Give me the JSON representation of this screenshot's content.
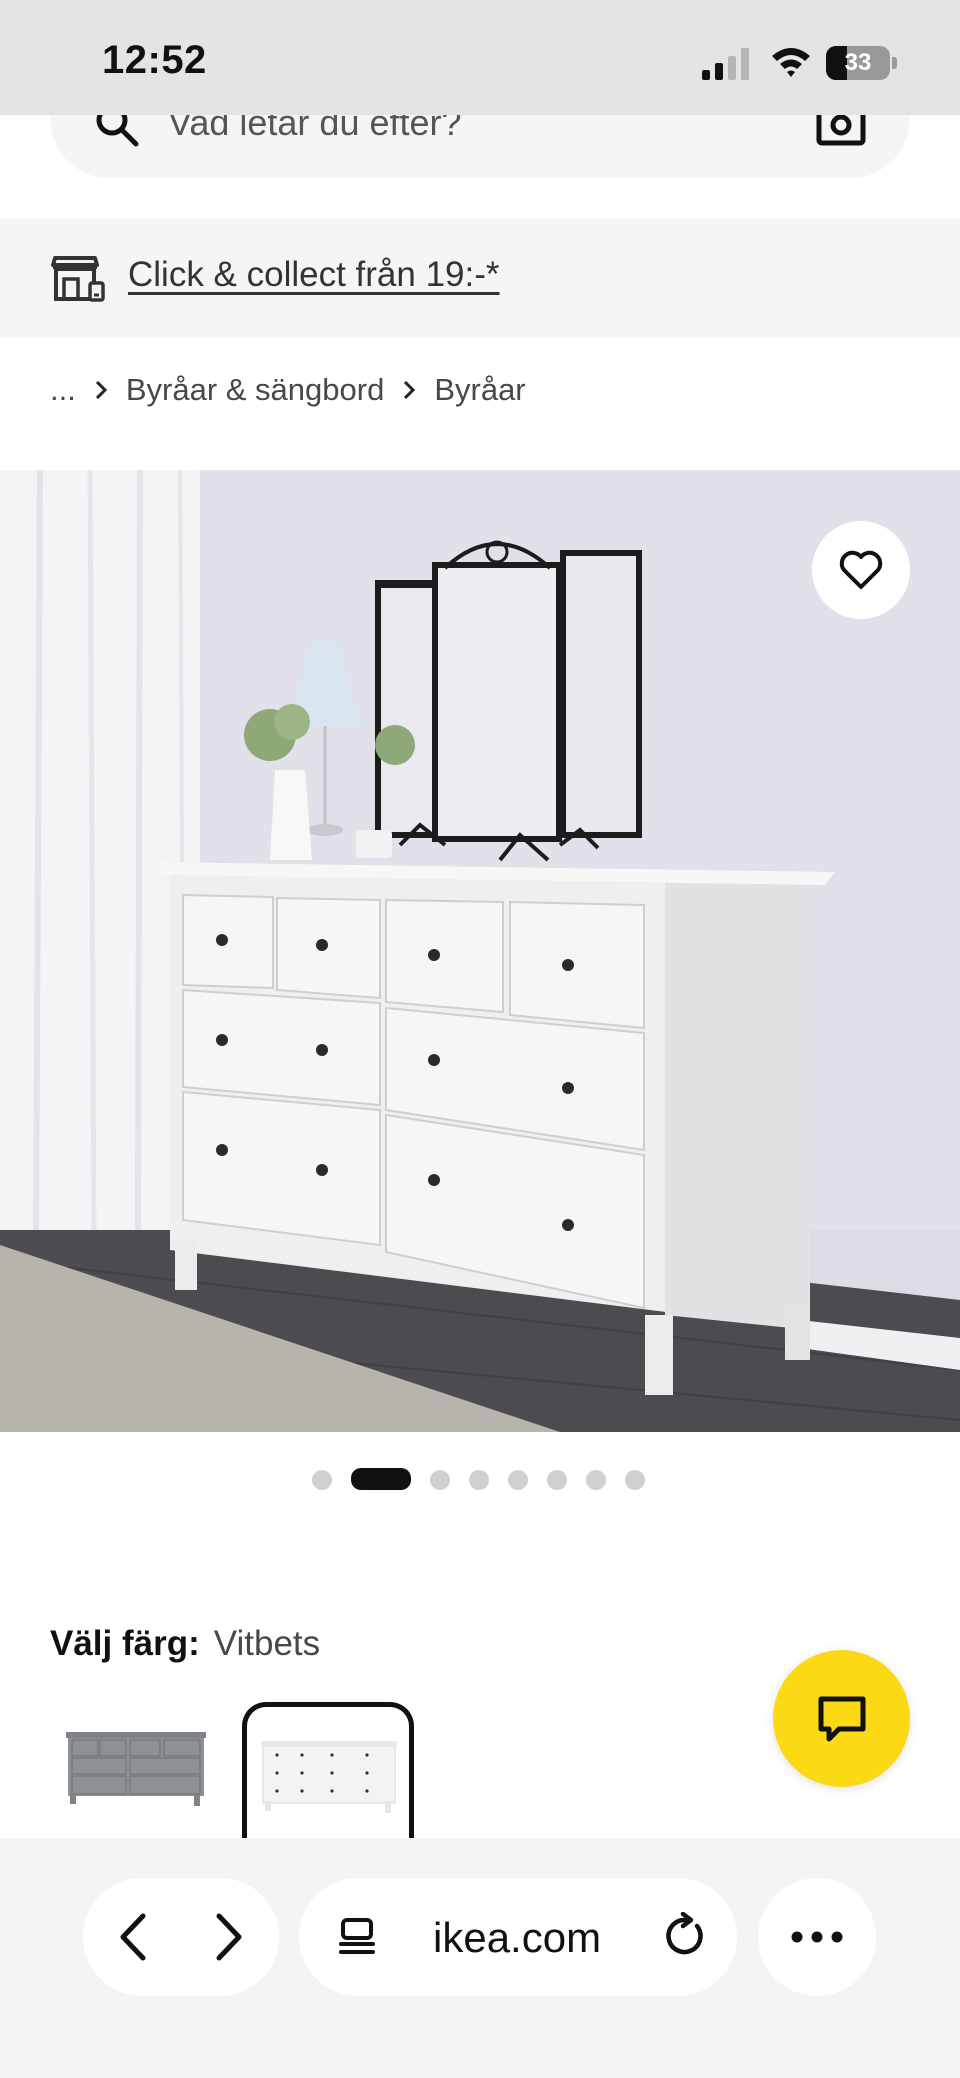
{
  "status_bar": {
    "time": "12:52",
    "battery_level": 33,
    "battery_text": "33",
    "signal_bars_active": 2
  },
  "search": {
    "placeholder": "Vad letar du efter?"
  },
  "collect_banner": {
    "label": "Click & collect från 19:-*"
  },
  "breadcrumb": {
    "items": [
      "...",
      "Byråar & sängbord",
      "Byråar"
    ]
  },
  "gallery": {
    "dot_count": 8,
    "active_index": 1
  },
  "color_select": {
    "label": "Välj färg:",
    "value": "Vitbets",
    "options": [
      "gray",
      "white"
    ],
    "selected_index": 1
  },
  "browser": {
    "url": "ikea.com"
  },
  "colors": {
    "chat_yellow": "#fbd914",
    "status_gray": "#e4e4e4",
    "banner_gray": "#f5f5f5",
    "text_dark": "#111111"
  },
  "icons": [
    "search-icon",
    "camera-icon",
    "store-icon",
    "chevron-right-icon",
    "heart-icon",
    "chat-icon",
    "chevron-left-icon",
    "tabs-icon",
    "reload-icon",
    "ellipsis-icon"
  ]
}
